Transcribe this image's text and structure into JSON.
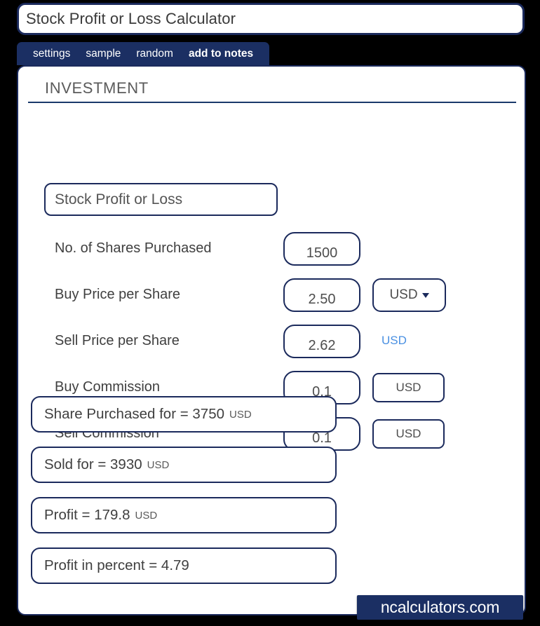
{
  "window": {
    "title": "Stock Profit or Loss Calculator"
  },
  "tabs": [
    {
      "label": "settings"
    },
    {
      "label": "sample"
    },
    {
      "label": "random"
    },
    {
      "label": "add to notes"
    }
  ],
  "section": {
    "heading": "INVESTMENT",
    "subtitle": "Stock Profit or Loss"
  },
  "fields": [
    {
      "label": "No. of Shares Purchased",
      "value": "1500",
      "unit": null,
      "unit_style": "none"
    },
    {
      "label": "Buy Price per Share",
      "value": "2.50",
      "unit": "USD",
      "unit_style": "dropdown"
    },
    {
      "label": "Sell Price per Share",
      "value": "2.62",
      "unit": "USD",
      "unit_style": "link"
    },
    {
      "label": "Buy Commission",
      "value": "0.1",
      "unit": "USD",
      "unit_style": "box"
    },
    {
      "label": "Sell Commission",
      "value": "0.1",
      "unit": "USD",
      "unit_style": "box"
    }
  ],
  "results": [
    {
      "text": "Share Purchased for  =  3750",
      "unit": "USD"
    },
    {
      "text": "Sold for  =  3930",
      "unit": "USD"
    },
    {
      "text": "Profit  =  179.8",
      "unit": "USD"
    },
    {
      "text": "Profit in percent  =  4.79",
      "unit": ""
    }
  ],
  "watermark": {
    "label": "ncalculators.com"
  },
  "colors": {
    "navy": "#1b2f63",
    "border": "#1b2a5c",
    "link_blue": "#4a90e2",
    "background": "#000000"
  }
}
